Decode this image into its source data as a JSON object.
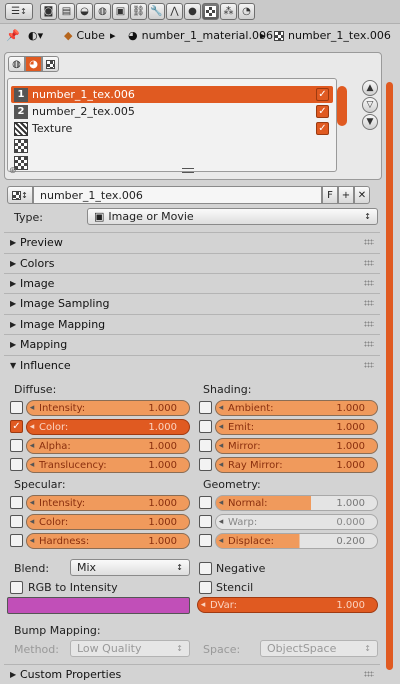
{
  "toolbar": {
    "editor_icon": "texture-editor-icon",
    "context_icons": [
      "render-icon",
      "render-layers-icon",
      "scene-icon",
      "world-icon",
      "object-icon",
      "constraints-icon",
      "modifiers-icon",
      "data-icon",
      "material-icon",
      "texture-icon",
      "particles-icon",
      "physics-icon"
    ],
    "active_context": "texture"
  },
  "breadcrumb": {
    "items": [
      {
        "label": "Cube",
        "icon": "cube-icon"
      },
      {
        "label": "number_1_material.006",
        "icon": "material-sphere-icon"
      },
      {
        "label": "number_1_tex.006",
        "icon": "checker-texture-icon"
      }
    ]
  },
  "slots": {
    "tabs": [
      "world-tab",
      "material-tab",
      "brush-tab"
    ],
    "items": [
      {
        "label": "number_1_tex.006",
        "icon": "slot-1-icon",
        "enabled": true,
        "selected": true
      },
      {
        "label": "number_2_tex.005",
        "icon": "slot-2-icon",
        "enabled": true,
        "selected": false
      },
      {
        "label": "Texture",
        "icon": "stripes-texture-icon",
        "enabled": true,
        "selected": false
      },
      {
        "label": "",
        "icon": "checker-texture-icon",
        "enabled": false,
        "selected": false
      },
      {
        "label": "",
        "icon": "checker-texture-icon",
        "enabled": false,
        "selected": false
      }
    ],
    "side_buttons": [
      "▲",
      "▽",
      "▼"
    ]
  },
  "texture_id": {
    "name": "number_1_tex.006",
    "fake_user": "F",
    "new": "+",
    "unlink": "✕"
  },
  "type": {
    "label": "Type:",
    "value": "Image or Movie"
  },
  "sections": [
    "Preview",
    "Colors",
    "Image",
    "Image Sampling",
    "Image Mapping",
    "Mapping"
  ],
  "influence": {
    "title": "Influence",
    "diffuse_label": "Diffuse:",
    "shading_label": "Shading:",
    "specular_label": "Specular:",
    "geometry_label": "Geometry:",
    "diffuse": [
      {
        "label": "Intensity:",
        "value": "1.000",
        "checked": false
      },
      {
        "label": "Color:",
        "value": "1.000",
        "checked": true
      },
      {
        "label": "Alpha:",
        "value": "1.000",
        "checked": false
      },
      {
        "label": "Translucency:",
        "value": "1.000",
        "checked": false
      }
    ],
    "shading": [
      {
        "label": "Ambient:",
        "value": "1.000",
        "checked": false
      },
      {
        "label": "Emit:",
        "value": "1.000",
        "checked": false
      },
      {
        "label": "Mirror:",
        "value": "1.000",
        "checked": false
      },
      {
        "label": "Ray Mirror:",
        "value": "1.000",
        "checked": false
      }
    ],
    "specular": [
      {
        "label": "Intensity:",
        "value": "1.000",
        "checked": false
      },
      {
        "label": "Color:",
        "value": "1.000",
        "checked": false
      },
      {
        "label": "Hardness:",
        "value": "1.000",
        "checked": false
      }
    ],
    "geometry": [
      {
        "label": "Normal:",
        "value": "1.000",
        "checked": false
      },
      {
        "label": "Warp:",
        "value": "0.000",
        "checked": false
      },
      {
        "label": "Displace:",
        "value": "0.200",
        "checked": false
      }
    ],
    "blend_label": "Blend:",
    "blend_value": "Mix",
    "negative_label": "Negative",
    "rgb_to_intensity_label": "RGB to Intensity",
    "stencil_label": "Stencil",
    "color_value": "#c14fb8",
    "dvar_label": "DVar:",
    "dvar_value": "1.000",
    "bump_mapping_label": "Bump Mapping:",
    "method_label": "Method:",
    "method_value": "Low Quality",
    "space_label": "Space:",
    "space_value": "ObjectSpace"
  },
  "custom_properties": "Custom Properties",
  "colors": {
    "accent": "#e05a21",
    "field": "#f09a5c",
    "swatch": "#c14fb8"
  }
}
